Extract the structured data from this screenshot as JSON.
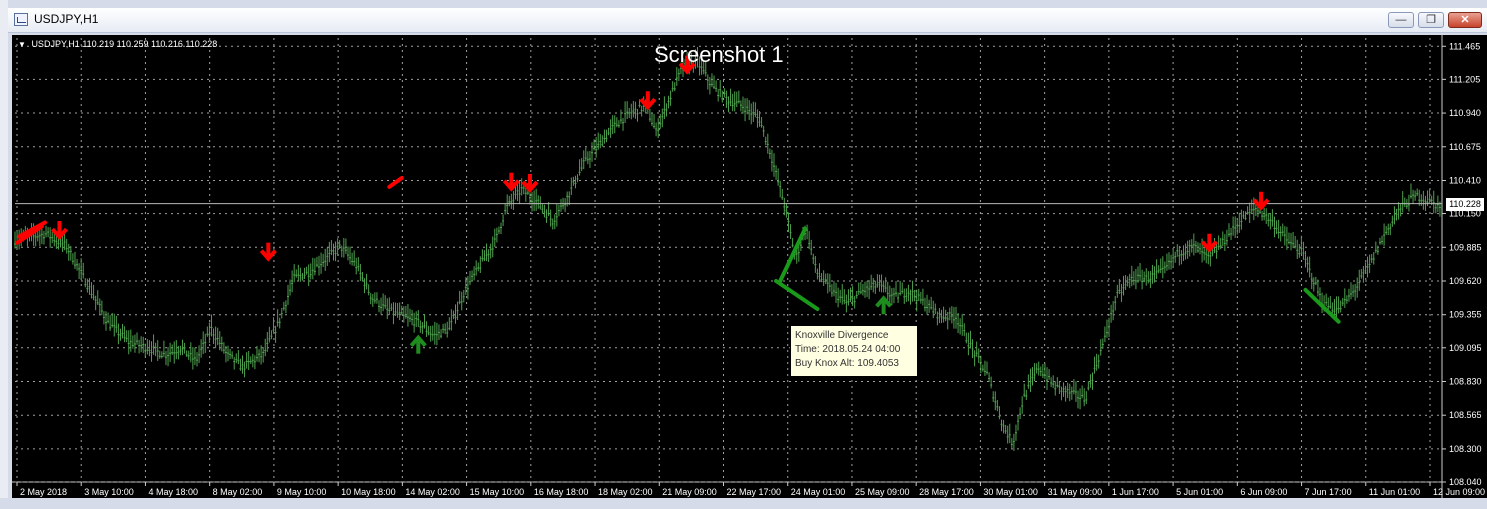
{
  "window": {
    "title": "USDJPY,H1",
    "minimize_glyph": "—",
    "restore_glyph": "❐",
    "close_glyph": "✕"
  },
  "chart_header": {
    "symbol": "USDJPY,H1",
    "ohlc": "110.219 110.259 110.216 110.228"
  },
  "screenshot_label": "Screenshot 1",
  "current_price": "110.228",
  "tooltip": {
    "line1": "Knoxville Divergence",
    "line2": "Time: 2018.05.24 04:00",
    "line3": "Buy Knox Alt: 109.4053"
  },
  "colors": {
    "background": "#000000",
    "grid": "#a0a0a0",
    "candle": "#4fa14f",
    "sell_arrow": "#ff0000",
    "buy_arrow": "#1e8c1e",
    "divergence_line": "#1a9a1a"
  },
  "chart_data": {
    "type": "bar",
    "timeframe": "H1",
    "ylim": [
      108.04,
      111.53
    ],
    "y_ticks": [
      "111.465",
      "111.205",
      "110.940",
      "110.675",
      "110.410",
      "110.150",
      "109.885",
      "109.620",
      "109.355",
      "109.095",
      "108.830",
      "108.565",
      "108.300",
      "108.040"
    ],
    "x_ticks": [
      "2 May 2018",
      "3 May 10:00",
      "4 May 18:00",
      "8 May 02:00",
      "9 May 10:00",
      "10 May 18:00",
      "14 May 02:00",
      "15 May 10:00",
      "16 May 18:00",
      "18 May 02:00",
      "21 May 09:00",
      "22 May 17:00",
      "24 May 01:00",
      "25 May 09:00",
      "28 May 17:00",
      "30 May 01:00",
      "31 May 09:00",
      "1 Jun 17:00",
      "5 Jun 01:00",
      "6 Jun 09:00",
      "7 Jun 17:00",
      "11 Jun 01:00",
      "12 Jun 09:00"
    ],
    "grid": true,
    "price_path": [
      [
        0,
        109.95
      ],
      [
        3,
        110.0
      ],
      [
        5,
        109.9
      ],
      [
        7,
        109.6
      ],
      [
        9,
        109.3
      ],
      [
        11,
        109.15
      ],
      [
        13,
        109.1
      ],
      [
        14.5,
        109.05
      ],
      [
        16,
        109.1
      ],
      [
        17.5,
        109.0
      ],
      [
        19,
        109.25
      ],
      [
        20.5,
        109.05
      ],
      [
        22,
        108.95
      ],
      [
        24,
        109.05
      ],
      [
        25.5,
        109.3
      ],
      [
        27,
        109.65
      ],
      [
        28.5,
        109.7
      ],
      [
        30,
        109.8
      ],
      [
        31.5,
        109.9
      ],
      [
        33,
        109.75
      ],
      [
        34.5,
        109.5
      ],
      [
        36,
        109.4
      ],
      [
        37.5,
        109.35
      ],
      [
        39,
        109.3
      ],
      [
        40.5,
        109.2
      ],
      [
        42,
        109.25
      ],
      [
        43.5,
        109.55
      ],
      [
        45,
        109.75
      ],
      [
        46.5,
        109.95
      ],
      [
        47.5,
        110.2
      ],
      [
        49,
        110.35
      ],
      [
        50.5,
        110.25
      ],
      [
        52,
        110.1
      ],
      [
        53.5,
        110.3
      ],
      [
        55,
        110.55
      ],
      [
        56.5,
        110.7
      ],
      [
        58,
        110.85
      ],
      [
        59.5,
        110.95
      ],
      [
        61,
        111.0
      ],
      [
        62,
        110.8
      ],
      [
        63,
        111.0
      ],
      [
        64.5,
        111.3
      ],
      [
        66,
        111.35
      ],
      [
        67.5,
        111.15
      ],
      [
        69,
        111.05
      ],
      [
        70.5,
        111.0
      ],
      [
        72,
        110.9
      ],
      [
        73,
        110.65
      ],
      [
        74.5,
        110.2
      ],
      [
        75.5,
        109.8
      ],
      [
        76.5,
        110.05
      ],
      [
        77.5,
        109.7
      ],
      [
        79,
        109.55
      ],
      [
        80.5,
        109.45
      ],
      [
        82,
        109.55
      ],
      [
        83.5,
        109.6
      ],
      [
        85,
        109.5
      ],
      [
        86.5,
        109.55
      ],
      [
        88,
        109.45
      ],
      [
        89.5,
        109.35
      ],
      [
        91,
        109.35
      ],
      [
        92.5,
        109.1
      ],
      [
        94,
        108.9
      ],
      [
        95.5,
        108.5
      ],
      [
        96.5,
        108.35
      ],
      [
        97.5,
        108.7
      ],
      [
        99,
        108.95
      ],
      [
        100.5,
        108.8
      ],
      [
        102,
        108.75
      ],
      [
        103.5,
        108.7
      ],
      [
        104.5,
        108.95
      ],
      [
        105.5,
        109.2
      ],
      [
        106.5,
        109.5
      ],
      [
        108,
        109.65
      ],
      [
        109.5,
        109.65
      ],
      [
        111,
        109.7
      ],
      [
        112.5,
        109.85
      ],
      [
        114,
        109.9
      ],
      [
        115.5,
        109.8
      ],
      [
        117,
        109.95
      ],
      [
        118.5,
        110.1
      ],
      [
        120,
        110.2
      ],
      [
        121.5,
        110.1
      ],
      [
        123,
        109.95
      ],
      [
        124.5,
        109.85
      ],
      [
        125.5,
        109.65
      ],
      [
        126.5,
        109.45
      ],
      [
        128,
        109.4
      ],
      [
        129.5,
        109.55
      ],
      [
        131,
        109.75
      ],
      [
        132.5,
        110.0
      ],
      [
        134,
        110.2
      ],
      [
        135.5,
        110.3
      ],
      [
        137,
        110.25
      ],
      [
        138,
        110.2
      ]
    ],
    "sell_arrows": [
      [
        4.3,
        109.95
      ],
      [
        24.5,
        109.78
      ],
      [
        48.0,
        110.33
      ],
      [
        49.8,
        110.32
      ],
      [
        61.2,
        110.97
      ],
      [
        65.0,
        111.25
      ],
      [
        115.5,
        109.85
      ],
      [
        120.5,
        110.18
      ]
    ],
    "buy_arrows": [
      [
        39.0,
        109.19
      ],
      [
        84.0,
        109.5
      ]
    ],
    "divergence_lines": [
      [
        [
          73.6,
          109.62
        ],
        [
          77.6,
          109.4
        ]
      ],
      [
        [
          74.0,
          109.62
        ],
        [
          76.4,
          110.03
        ]
      ],
      [
        [
          124.8,
          109.55
        ],
        [
          128.0,
          109.3
        ]
      ]
    ],
    "current_price_line": 110.228
  }
}
